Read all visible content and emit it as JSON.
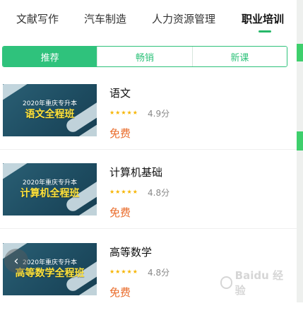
{
  "top_tabs": [
    {
      "label": "文献写作"
    },
    {
      "label": "汽车制造"
    },
    {
      "label": "人力资源管理"
    },
    {
      "label": "职业培训",
      "active": true
    }
  ],
  "segments": [
    {
      "label": "推荐",
      "active": true
    },
    {
      "label": "畅销"
    },
    {
      "label": "新课"
    }
  ],
  "courses": [
    {
      "thumb_line1": "2020年重庆专升本",
      "thumb_line2": "语文全程班",
      "title": "语文",
      "stars": 5,
      "rating": "4.9分",
      "price": "免费"
    },
    {
      "thumb_line1": "2020年重庆专升本",
      "thumb_line2": "计算机全程班",
      "title": "计算机基础",
      "stars": 5,
      "rating": "4.8分",
      "price": "免费"
    },
    {
      "thumb_line1": "2020年重庆专升本",
      "thumb_line2": "高等数学全程班",
      "title": "高等数学",
      "stars": 5,
      "rating": "4.8分",
      "price": "免费"
    }
  ],
  "colors": {
    "accent": "#2fc27c",
    "price": "#e96b2a",
    "star": "#f6b400"
  },
  "icons": {
    "prev": "chevron-left-icon",
    "watermark": "baidu-paw-icon"
  },
  "watermark": "Baidu 经验"
}
